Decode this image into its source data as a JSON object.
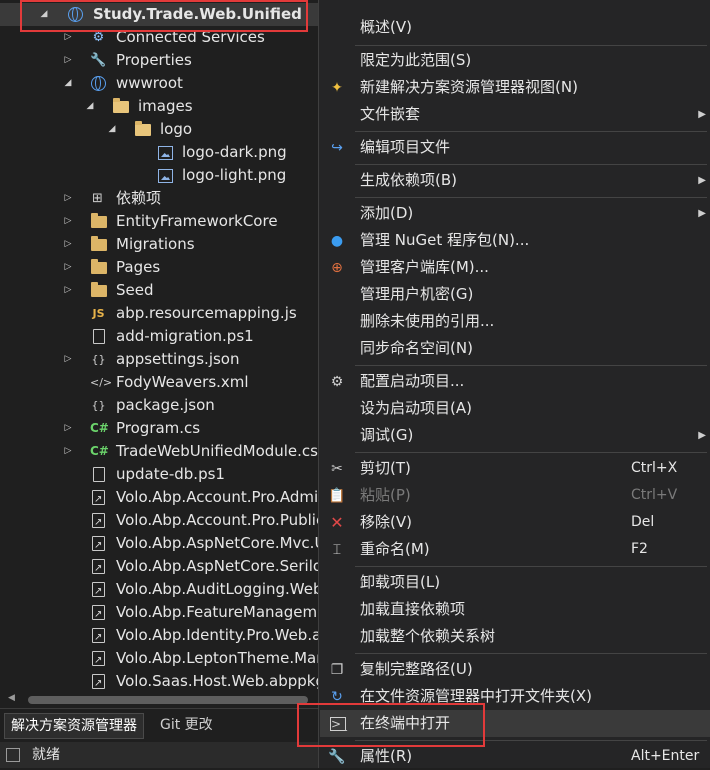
{
  "tree": {
    "items": [
      {
        "label": "Study.Trade.Web.Unified",
        "icon": "web-project-icon"
      },
      {
        "label": "Connected Services",
        "icon": "connected-services-icon"
      },
      {
        "label": "Properties",
        "icon": "wrench-icon"
      },
      {
        "label": "wwwroot",
        "icon": "globe-icon"
      },
      {
        "label": "images",
        "icon": "folder-icon"
      },
      {
        "label": "logo",
        "icon": "folder-icon"
      },
      {
        "label": "logo-dark.png",
        "icon": "image-file-icon"
      },
      {
        "label": "logo-light.png",
        "icon": "image-file-icon"
      },
      {
        "label": "依赖项",
        "icon": "dependencies-icon"
      },
      {
        "label": "EntityFrameworkCore",
        "icon": "folder-icon"
      },
      {
        "label": "Migrations",
        "icon": "folder-icon"
      },
      {
        "label": "Pages",
        "icon": "folder-icon"
      },
      {
        "label": "Seed",
        "icon": "folder-icon"
      },
      {
        "label": "abp.resourcemapping.js",
        "icon": "js-file-icon",
        "icon_text": "JS"
      },
      {
        "label": "add-migration.ps1",
        "icon": "file-icon"
      },
      {
        "label": "appsettings.json",
        "icon": "json-file-icon",
        "icon_text": "{}"
      },
      {
        "label": "FodyWeavers.xml",
        "icon": "xml-file-icon",
        "icon_text": "</>"
      },
      {
        "label": "package.json",
        "icon": "json-file-icon",
        "icon_text": "{}"
      },
      {
        "label": "Program.cs",
        "icon": "csharp-file-icon",
        "icon_text": "C#"
      },
      {
        "label": "TradeWebUnifiedModule.cs",
        "icon": "csharp-file-icon",
        "icon_text": "C#"
      },
      {
        "label": "update-db.ps1",
        "icon": "file-icon"
      },
      {
        "label": "Volo.Abp.Account.Pro.Admin",
        "icon": "reference-file-icon"
      },
      {
        "label": "Volo.Abp.Account.Pro.Public",
        "icon": "reference-file-icon"
      },
      {
        "label": "Volo.Abp.AspNetCore.Mvc.U",
        "icon": "reference-file-icon"
      },
      {
        "label": "Volo.Abp.AspNetCore.Serilog",
        "icon": "reference-file-icon"
      },
      {
        "label": "Volo.Abp.AuditLogging.Web",
        "icon": "reference-file-icon"
      },
      {
        "label": "Volo.Abp.FeatureManageme",
        "icon": "reference-file-icon"
      },
      {
        "label": "Volo.Abp.Identity.Pro.Web.ab",
        "icon": "reference-file-icon"
      },
      {
        "label": "Volo.Abp.LeptonTheme.Man",
        "icon": "reference-file-icon"
      },
      {
        "label": "Volo.Saas.Host.Web.abppkg",
        "icon": "reference-file-icon"
      }
    ]
  },
  "tabs": [
    "解决方案资源管理器",
    "Git 更改"
  ],
  "status": {
    "text": "就绪"
  },
  "menu": {
    "items": [
      {
        "label": "概述(V)"
      },
      {
        "label": "限定为此范围(S)"
      },
      {
        "label": "新建解决方案资源管理器视图(N)",
        "icon": "new-view-icon"
      },
      {
        "label": "文件嵌套",
        "submenu": true
      },
      {
        "label": "编辑项目文件",
        "icon": "edit-project-icon"
      },
      {
        "label": "生成依赖项(B)",
        "submenu": true
      },
      {
        "label": "添加(D)",
        "submenu": true
      },
      {
        "label": "管理 NuGet 程序包(N)...",
        "icon": "nuget-icon"
      },
      {
        "label": "管理客户端库(M)...",
        "icon": "client-library-icon"
      },
      {
        "label": "管理用户机密(G)"
      },
      {
        "label": "删除未使用的引用..."
      },
      {
        "label": "同步命名空间(N)"
      },
      {
        "label": "配置启动项目...",
        "icon": "gear-icon"
      },
      {
        "label": "设为启动项目(A)"
      },
      {
        "label": "调试(G)",
        "submenu": true
      },
      {
        "label": "剪切(T)",
        "shortcut": "Ctrl+X",
        "icon": "scissors-icon"
      },
      {
        "label": "粘贴(P)",
        "shortcut": "Ctrl+V",
        "icon": "clipboard-icon",
        "disabled": true
      },
      {
        "label": "移除(V)",
        "shortcut": "Del",
        "icon": "remove-icon"
      },
      {
        "label": "重命名(M)",
        "shortcut": "F2",
        "icon": "rename-icon"
      },
      {
        "label": "卸载项目(L)"
      },
      {
        "label": "加载直接依赖项"
      },
      {
        "label": "加载整个依赖关系树"
      },
      {
        "label": "复制完整路径(U)",
        "icon": "copy-icon"
      },
      {
        "label": "在文件资源管理器中打开文件夹(X)",
        "icon": "refresh-icon"
      },
      {
        "label": "在终端中打开",
        "icon": "terminal-icon"
      },
      {
        "label": "属性(R)",
        "shortcut": "Alt+Enter",
        "icon": "wrench-icon"
      }
    ]
  },
  "colors": {
    "accent_highlight": "#e23a3a",
    "background": "#1f1f1f",
    "menu_background": "#252526"
  }
}
